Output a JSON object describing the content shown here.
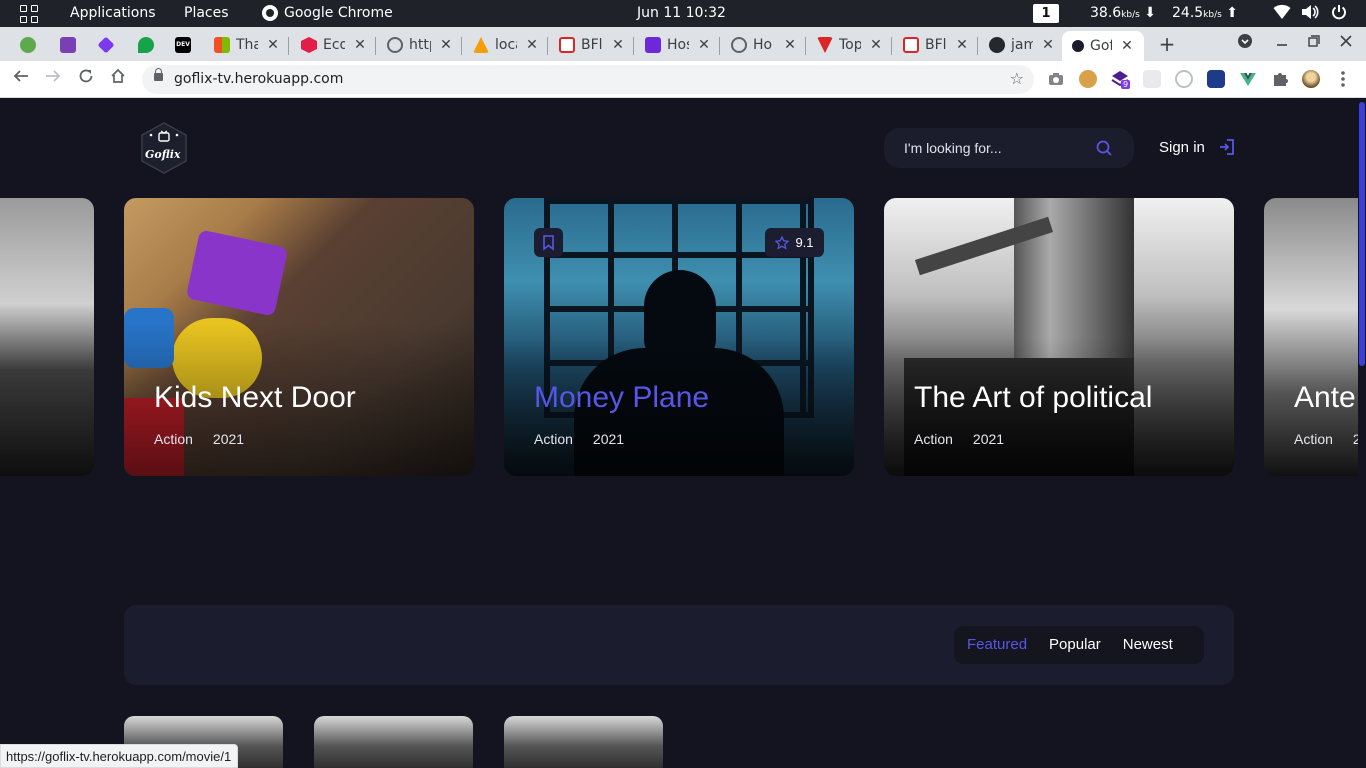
{
  "desktop": {
    "applications": "Applications",
    "places": "Places",
    "active_app": "Google Chrome",
    "clock": "Jun 11  10:32",
    "workspace": "1",
    "net_down": "38.6",
    "net_up": "24.5",
    "net_unit": "kb/s",
    "down_arrow": "⬇",
    "up_arrow": "⬆"
  },
  "browser": {
    "tabs": [
      {
        "label": "",
        "favicon": "ok-icon",
        "color": "#5ea84d"
      },
      {
        "label": "",
        "favicon": "purple-square-icon",
        "color": "#7b3fb5"
      },
      {
        "label": "",
        "favicon": "cube-icon",
        "color": "#7c3aed"
      },
      {
        "label": "",
        "favicon": "green-bird-icon",
        "color": "#16a34a"
      },
      {
        "label": "",
        "favicon": "dev-icon",
        "color": "#000000",
        "text": "DEV"
      },
      {
        "label": "Tha",
        "favicon": "windows-icon",
        "color": "#f25022"
      },
      {
        "label": "Eco",
        "favicon": "hex-icon",
        "color": "#e11d48"
      },
      {
        "label": "http",
        "favicon": "globe-icon",
        "color": "#5f6368"
      },
      {
        "label": "loca",
        "favicon": "pma-icon",
        "color": "#f59e0b"
      },
      {
        "label": "BFl",
        "favicon": "bf-icon",
        "color": "#dc2626"
      },
      {
        "label": "Hos",
        "favicon": "h-icon",
        "color": "#6d28d9"
      },
      {
        "label": "Ho",
        "favicon": "globe-icon",
        "color": "#5f6368"
      },
      {
        "label": "Top",
        "favicon": "v-icon",
        "color": "#dc2626"
      },
      {
        "label": "BFl",
        "favicon": "bf-icon",
        "color": "#dc2626"
      },
      {
        "label": "jam",
        "favicon": "github-icon",
        "color": "#24292e"
      },
      {
        "label": "Gof",
        "favicon": "goflix-icon",
        "color": "#1b1c2d",
        "active": true
      }
    ],
    "new_tab": "+",
    "url": "goflix-tv.herokuapp.com",
    "status_url": "https://goflix-tv.herokuapp.com/movie/1",
    "extension_badge": "9"
  },
  "site": {
    "logo_text": "Goflix",
    "search_placeholder": "I'm looking for...",
    "sign_in": "Sign in",
    "slides": [
      {
        "title": "",
        "genre": "",
        "year": ""
      },
      {
        "title": "Kids Next Door",
        "genre": "Action",
        "year": "2021"
      },
      {
        "title": "Money Plane",
        "genre": "Action",
        "year": "2021",
        "rating": "9.1",
        "highlight": true
      },
      {
        "title": "The Art of political",
        "genre": "Action",
        "year": "2021"
      },
      {
        "title": "Ante",
        "genre": "Action",
        "year": "2"
      }
    ],
    "filters": [
      "Featured",
      "Popular",
      "Newest"
    ],
    "active_filter": "Featured"
  },
  "colors": {
    "accent": "#5856e6",
    "page_bg": "#13141f",
    "panel_bg": "#1b1c2d"
  }
}
